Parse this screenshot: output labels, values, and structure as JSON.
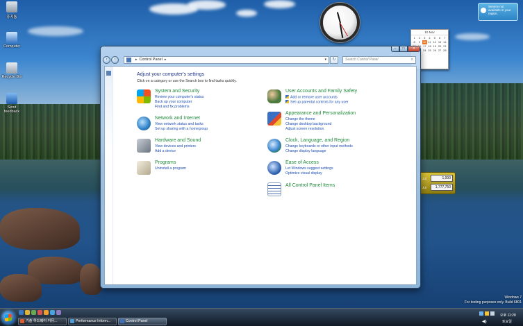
{
  "desktop": {
    "icons": [
      {
        "label": "휴지통"
      },
      {
        "label": "Computer"
      },
      {
        "label": "Recycle Bin"
      },
      {
        "label": "Send feedback"
      }
    ]
  },
  "gadgets": {
    "calendar": {
      "month_label": "10 Nov",
      "days": [
        "1",
        "2",
        "3",
        "4",
        "5",
        "6",
        "7",
        "8",
        "9",
        "10",
        "11",
        "12",
        "13",
        "14",
        "15",
        "16",
        "17",
        "18",
        "19",
        "20",
        "21",
        "22",
        "23",
        "24",
        "25",
        "26",
        "27",
        "28",
        "29",
        "30"
      ],
      "today": "10"
    },
    "notification": {
      "text": "Service not available in your region."
    },
    "stocks": {
      "rows": [
        {
          "label": "Jul",
          "value": "1,000"
        },
        {
          "label": "Jul",
          "value": "1,777,750"
        }
      ]
    }
  },
  "window": {
    "title": "Control Panel",
    "address": {
      "crumb": "Control Panel"
    },
    "search": {
      "placeholder": "Search Control Panel"
    },
    "heading": "Adjust your computer's settings",
    "subheading": "Click on a category or use the Search box to find tasks quickly.",
    "categories": [
      {
        "title": "System and Security",
        "links": [
          "Review your computer's status",
          "Back up your computer",
          "Find and fix problems"
        ],
        "icon": "system-security-icon"
      },
      {
        "title": "Network and Internet",
        "links": [
          "View network status and tasks",
          "Set up sharing with a homegroup"
        ],
        "icon": "network-icon"
      },
      {
        "title": "Hardware and Sound",
        "links": [
          "View devices and printers",
          "Add a device"
        ],
        "icon": "hardware-sound-icon"
      },
      {
        "title": "Programs",
        "links": [
          "Uninstall a program"
        ],
        "icon": "programs-icon"
      },
      {
        "title": "User Accounts and Family Safety",
        "links": [
          "Add or remove user accounts",
          "Set up parental controls for any user"
        ],
        "icon": "user-accounts-icon"
      },
      {
        "title": "Appearance and Personalization",
        "links": [
          "Change the theme",
          "Change desktop background",
          "Adjust screen resolution"
        ],
        "icon": "appearance-icon"
      },
      {
        "title": "Clock, Language, and Region",
        "links": [
          "Change keyboards or other input methods",
          "Change display language"
        ],
        "icon": "clock-language-icon"
      },
      {
        "title": "Ease of Access",
        "links": [
          "Let Windows suggest settings",
          "Optimize visual display"
        ],
        "icon": "ease-of-access-icon"
      },
      {
        "title": "All Control Panel Items",
        "links": [],
        "icon": "all-items-icon"
      }
    ]
  },
  "taskbar": {
    "buttons": [
      {
        "label": "기술 하드웨어 커뮤..."
      },
      {
        "label": "Performance Inform..."
      },
      {
        "label": "Control Panel"
      }
    ],
    "tray": {
      "time": "오후 11:28",
      "day": "토요일"
    }
  },
  "watermark": {
    "line1": "Windows 7",
    "line2": "For testing purposes only. Build 6801"
  },
  "colors": {
    "category_title": "#1d8a3a",
    "link": "#1e50b4",
    "heading": "#1e3287",
    "close_button": "#c1412a"
  }
}
